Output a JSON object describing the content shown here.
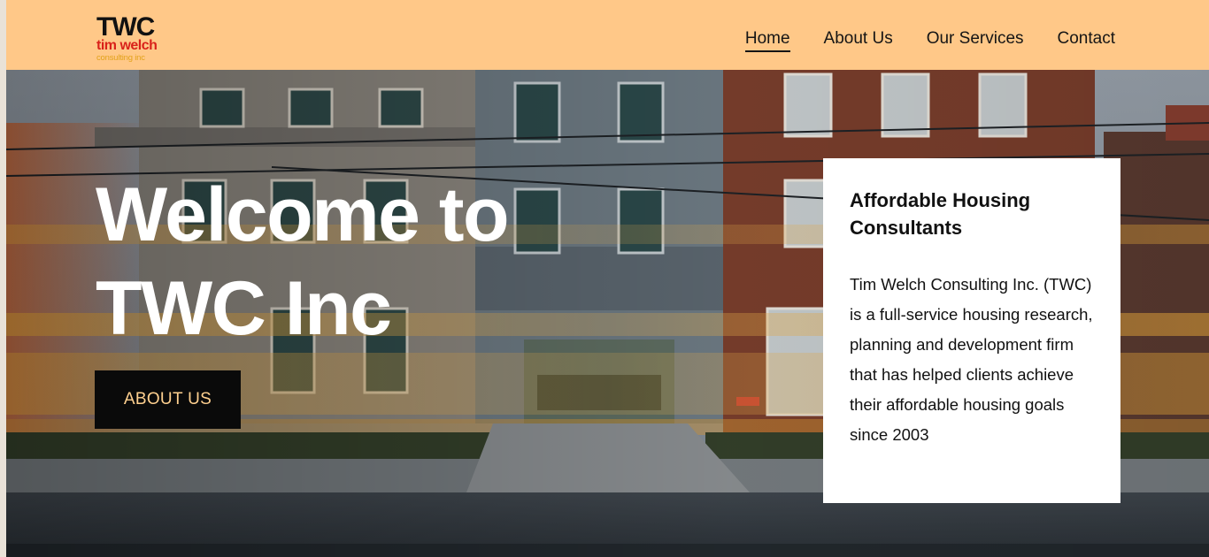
{
  "logo": {
    "main": "TWC",
    "sub": "tim welch",
    "tagline": "consulting inc"
  },
  "nav": {
    "items": [
      {
        "label": "Home",
        "active": true
      },
      {
        "label": "About Us"
      },
      {
        "label": "Our Services"
      },
      {
        "label": "Contact"
      }
    ]
  },
  "hero": {
    "title_line1": "Welcome to",
    "title_line2": "TWC Inc",
    "cta_label": "ABOUT US"
  },
  "card": {
    "heading": "Affordable Housing Consultants",
    "body": "Tim Welch Consulting Inc. (TWC) is a full-service housing research, planning and development firm that has helped clients achieve their affordable housing goals since 2003"
  },
  "colors": {
    "header_bg": "#ffc888",
    "cta_bg": "#0a0a0a",
    "cta_text": "#ffd08f",
    "logo_red": "#d9221a",
    "logo_gold": "#e2a21b"
  }
}
